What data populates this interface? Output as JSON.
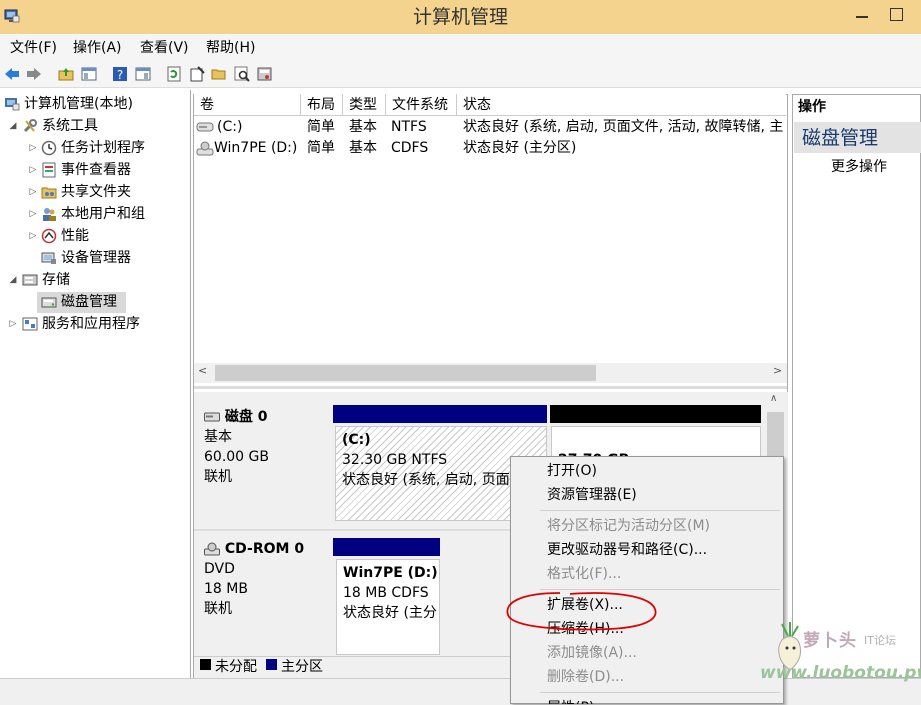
{
  "window": {
    "title": "计算机管理"
  },
  "menu": [
    "文件(F)",
    "操作(A)",
    "查看(V)",
    "帮助(H)"
  ],
  "tree": {
    "root": "计算机管理(本地)",
    "system_tools": "系统工具",
    "task_scheduler": "任务计划程序",
    "event_viewer": "事件查看器",
    "shared_folders": "共享文件夹",
    "local_users": "本地用户和组",
    "performance": "性能",
    "device_manager": "设备管理器",
    "storage": "存储",
    "disk_management": "磁盘管理",
    "services_apps": "服务和应用程序"
  },
  "volume_table": {
    "headers": [
      "卷",
      "布局",
      "类型",
      "文件系统",
      "状态"
    ],
    "rows": [
      [
        "(C:)",
        "简单",
        "基本",
        "NTFS",
        "状态良好 (系统, 启动, 页面文件, 活动, 故障转储, 主"
      ],
      [
        "Win7PE (D:)",
        "简单",
        "基本",
        "CDFS",
        "状态良好 (主分区)"
      ]
    ]
  },
  "disks": [
    {
      "name": "磁盘 0",
      "type": "基本",
      "size": "60.00 GB",
      "state": "联机",
      "partition": {
        "name": "(C:)",
        "size_fs": "32.30 GB NTFS",
        "status": "状态良好 (系统, 启动, 页面"
      },
      "unallocated_label": "27.70 GB"
    },
    {
      "name": "CD-ROM 0",
      "type": "DVD",
      "size": "18 MB",
      "state": "联机",
      "partition": {
        "name": "Win7PE  (D:)",
        "size_fs": "18 MB CDFS",
        "status": "状态良好 (主分"
      }
    }
  ],
  "legend": {
    "unallocated": "未分配",
    "primary": "主分区"
  },
  "actions": {
    "header": "操作",
    "section": "磁盘管理",
    "more": "更多操作"
  },
  "context_menu": {
    "open": "打开(O)",
    "explorer": "资源管理器(E)",
    "mark_active": "将分区标记为活动分区(M)",
    "change_letter": "更改驱动器号和路径(C)...",
    "format": "格式化(F)...",
    "extend": "扩展卷(X)...",
    "shrink": "压缩卷(H)...",
    "add_mirror": "添加镜像(A)...",
    "delete": "删除卷(D)...",
    "properties": "属性(P)"
  },
  "watermark": {
    "site": "萝卜头",
    "forum": "IT论坛",
    "url": "www.luobotou.pw"
  },
  "colors": {
    "titlebar": "#f3d38e",
    "primary_partition": "#000080",
    "unallocated": "#000000",
    "annotation": "#e00000"
  }
}
